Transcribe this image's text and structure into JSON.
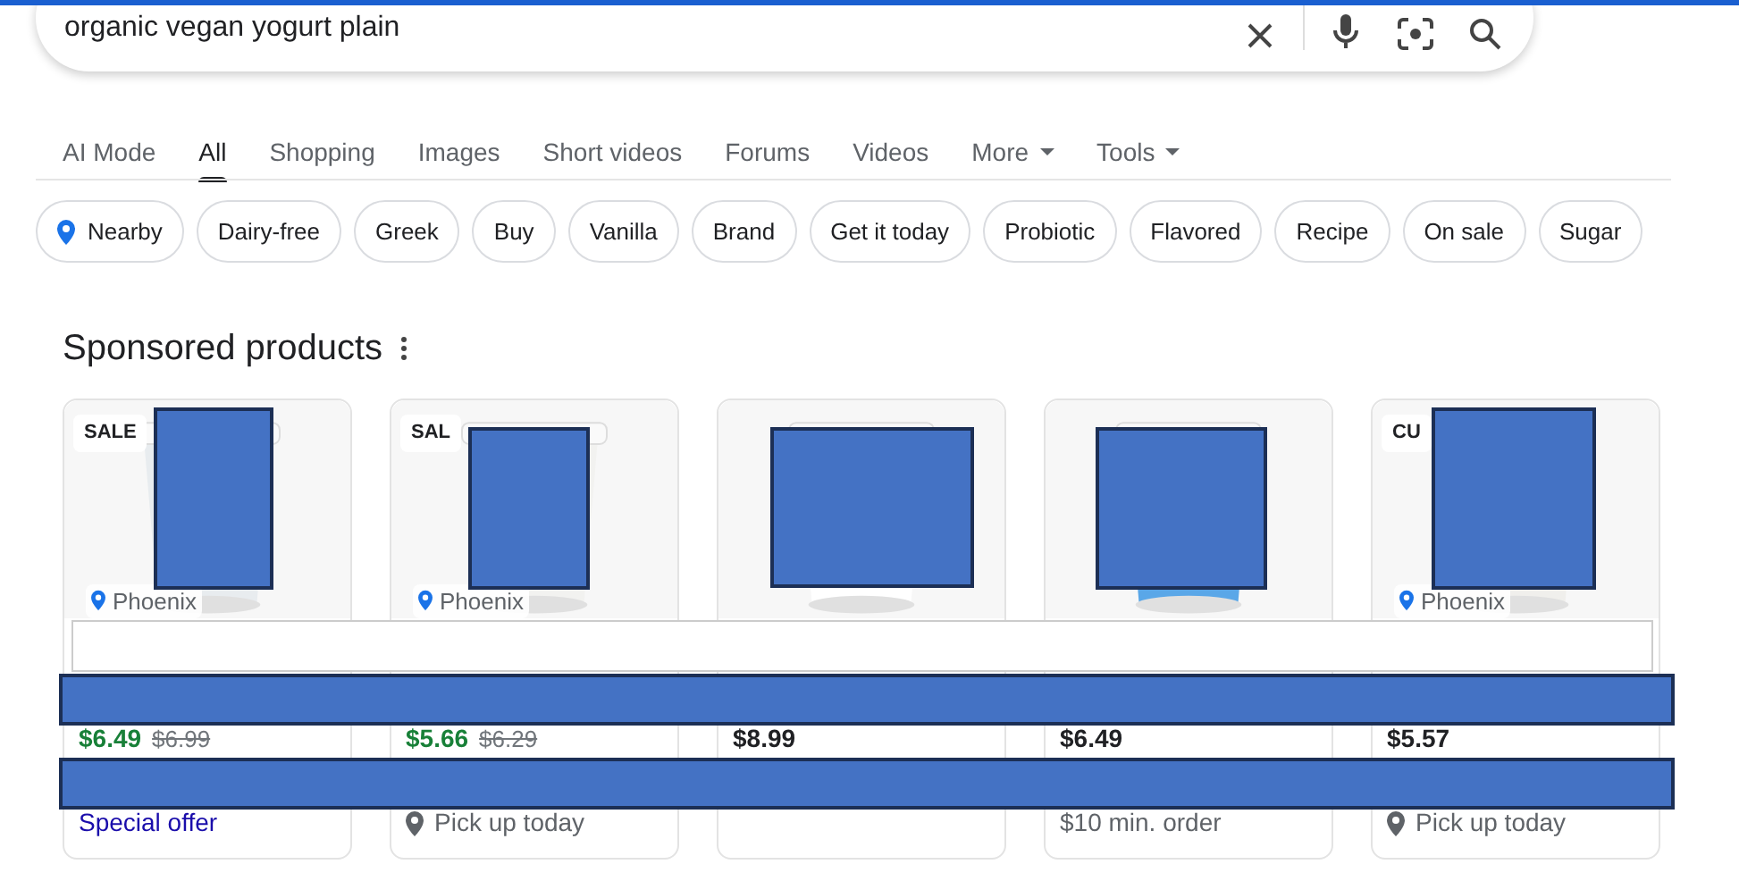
{
  "search": {
    "value": "organic vegan yogurt plain"
  },
  "tabs": [
    {
      "label": "AI Mode",
      "selected": false,
      "dropdown": false
    },
    {
      "label": "All",
      "selected": true,
      "dropdown": false
    },
    {
      "label": "Shopping",
      "selected": false,
      "dropdown": false
    },
    {
      "label": "Images",
      "selected": false,
      "dropdown": false
    },
    {
      "label": "Short videos",
      "selected": false,
      "dropdown": false
    },
    {
      "label": "Forums",
      "selected": false,
      "dropdown": false
    },
    {
      "label": "Videos",
      "selected": false,
      "dropdown": false
    },
    {
      "label": "More",
      "selected": false,
      "dropdown": true
    },
    {
      "label": "Tools",
      "selected": false,
      "dropdown": true
    }
  ],
  "chips": [
    {
      "label": "Nearby",
      "kind": "location"
    },
    {
      "label": "Dairy-free",
      "kind": "plain"
    },
    {
      "label": "Greek",
      "kind": "plain"
    },
    {
      "label": "Buy",
      "kind": "plain"
    },
    {
      "label": "Vanilla",
      "kind": "plain"
    },
    {
      "label": "Brand",
      "kind": "plain"
    },
    {
      "label": "Get it today",
      "kind": "plain"
    },
    {
      "label": "Probiotic",
      "kind": "plain"
    },
    {
      "label": "Flavored",
      "kind": "plain"
    },
    {
      "label": "Recipe",
      "kind": "plain"
    },
    {
      "label": "On sale",
      "kind": "plain"
    },
    {
      "label": "Sugar",
      "kind": "plain"
    }
  ],
  "sponsored": {
    "title": "Sponsored products",
    "products": [
      {
        "badge": "SALE",
        "location": "Phoenix",
        "price": "$6.49",
        "old_price": "$6.99",
        "on_sale": true,
        "footer": {
          "kind": "offer",
          "text": "Special offer"
        }
      },
      {
        "badge": "SAL",
        "location": "Phoenix",
        "price": "$5.66",
        "old_price": "$6.29",
        "on_sale": true,
        "footer": {
          "kind": "pickup",
          "text": "Pick up today"
        }
      },
      {
        "price": "$8.99",
        "on_sale": false
      },
      {
        "price": "$6.49",
        "on_sale": false,
        "footer": {
          "kind": "note",
          "text": "$10 min. order"
        }
      },
      {
        "badge": "CU",
        "location": "Phoenix",
        "price": "$5.57",
        "on_sale": false,
        "footer": {
          "kind": "pickup",
          "text": "Pick up today"
        }
      }
    ]
  }
}
